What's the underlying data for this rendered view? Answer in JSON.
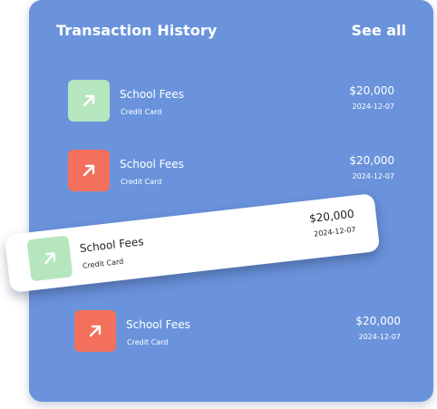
{
  "header": {
    "title": "Transaction History",
    "see_all_label": "See all"
  },
  "colors": {
    "panel_bg": "#6a93dc",
    "incoming_icon_bg": "#b6e6bd",
    "outgoing_icon_bg": "#f2705c"
  },
  "transactions": [
    {
      "name": "School Fees",
      "method": "Credit Card",
      "amount": "$20,000",
      "date": "2024-12-07",
      "icon": "arrow-up-right-icon",
      "icon_color": "green"
    },
    {
      "name": "School Fees",
      "method": "Credit Card",
      "amount": "$20,000",
      "date": "2024-12-07",
      "icon": "arrow-up-right-icon",
      "icon_color": "red"
    },
    {
      "name": "School Fees",
      "method": "Credit Card",
      "amount": "$20,000",
      "date": "2024-12-07",
      "icon": "arrow-up-right-icon",
      "icon_color": "green",
      "highlighted": true
    },
    {
      "name": "School Fees",
      "method": "Credit Card",
      "amount": "$20,000",
      "date": "2024-12-07",
      "icon": "arrow-up-right-icon",
      "icon_color": "red"
    }
  ]
}
